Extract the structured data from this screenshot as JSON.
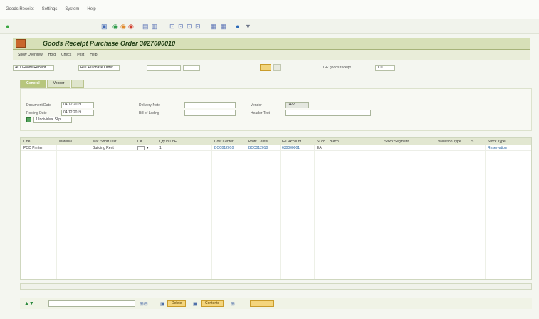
{
  "menu": [
    "Goods Receipt",
    "Settings",
    "System",
    "Help"
  ],
  "title": "Goods Receipt Purchase Order 3027000010",
  "app_toolbar": [
    "Show Overview",
    "Hold",
    "Check",
    "Post",
    "Help"
  ],
  "selection": [
    "A01 Goods Receipt",
    "R01 Purchase Order",
    "",
    "",
    "GR goods receipt",
    "101"
  ],
  "tabs": [
    "General",
    "Vendor",
    ""
  ],
  "header": {
    "doc_date_label": "Document Date",
    "doc_date": "04.12.2019",
    "post_date_label": "Posting Date",
    "post_date": "04.12.2019",
    "individual_slip": "1 Individual Slip",
    "delivery_note_label": "Delivery Note",
    "bill_label": "Bill of Lading",
    "vendor_label": "Vendor",
    "vendor_value": "7422",
    "header_text_label": "Header Text"
  },
  "columns": [
    "Line",
    "Material",
    "Mat. Short Text",
    "OK",
    "Qty in UnE",
    "Cost Center",
    "Profit Center",
    "G/L Account",
    "SLoc",
    "Batch",
    "Stock Segment",
    "Valuation Type",
    "S",
    "Stock Type"
  ],
  "row": {
    "line": "POD Printer",
    "short_text": "Building Rent",
    "qty": "1",
    "cost_center": "BCC012010",
    "profit_center": "BCC012010",
    "gl": "630000001",
    "sloc": "EA",
    "stock_type": "Reservation"
  },
  "footer": {
    "delete": "Delete",
    "contents": "Contents"
  }
}
